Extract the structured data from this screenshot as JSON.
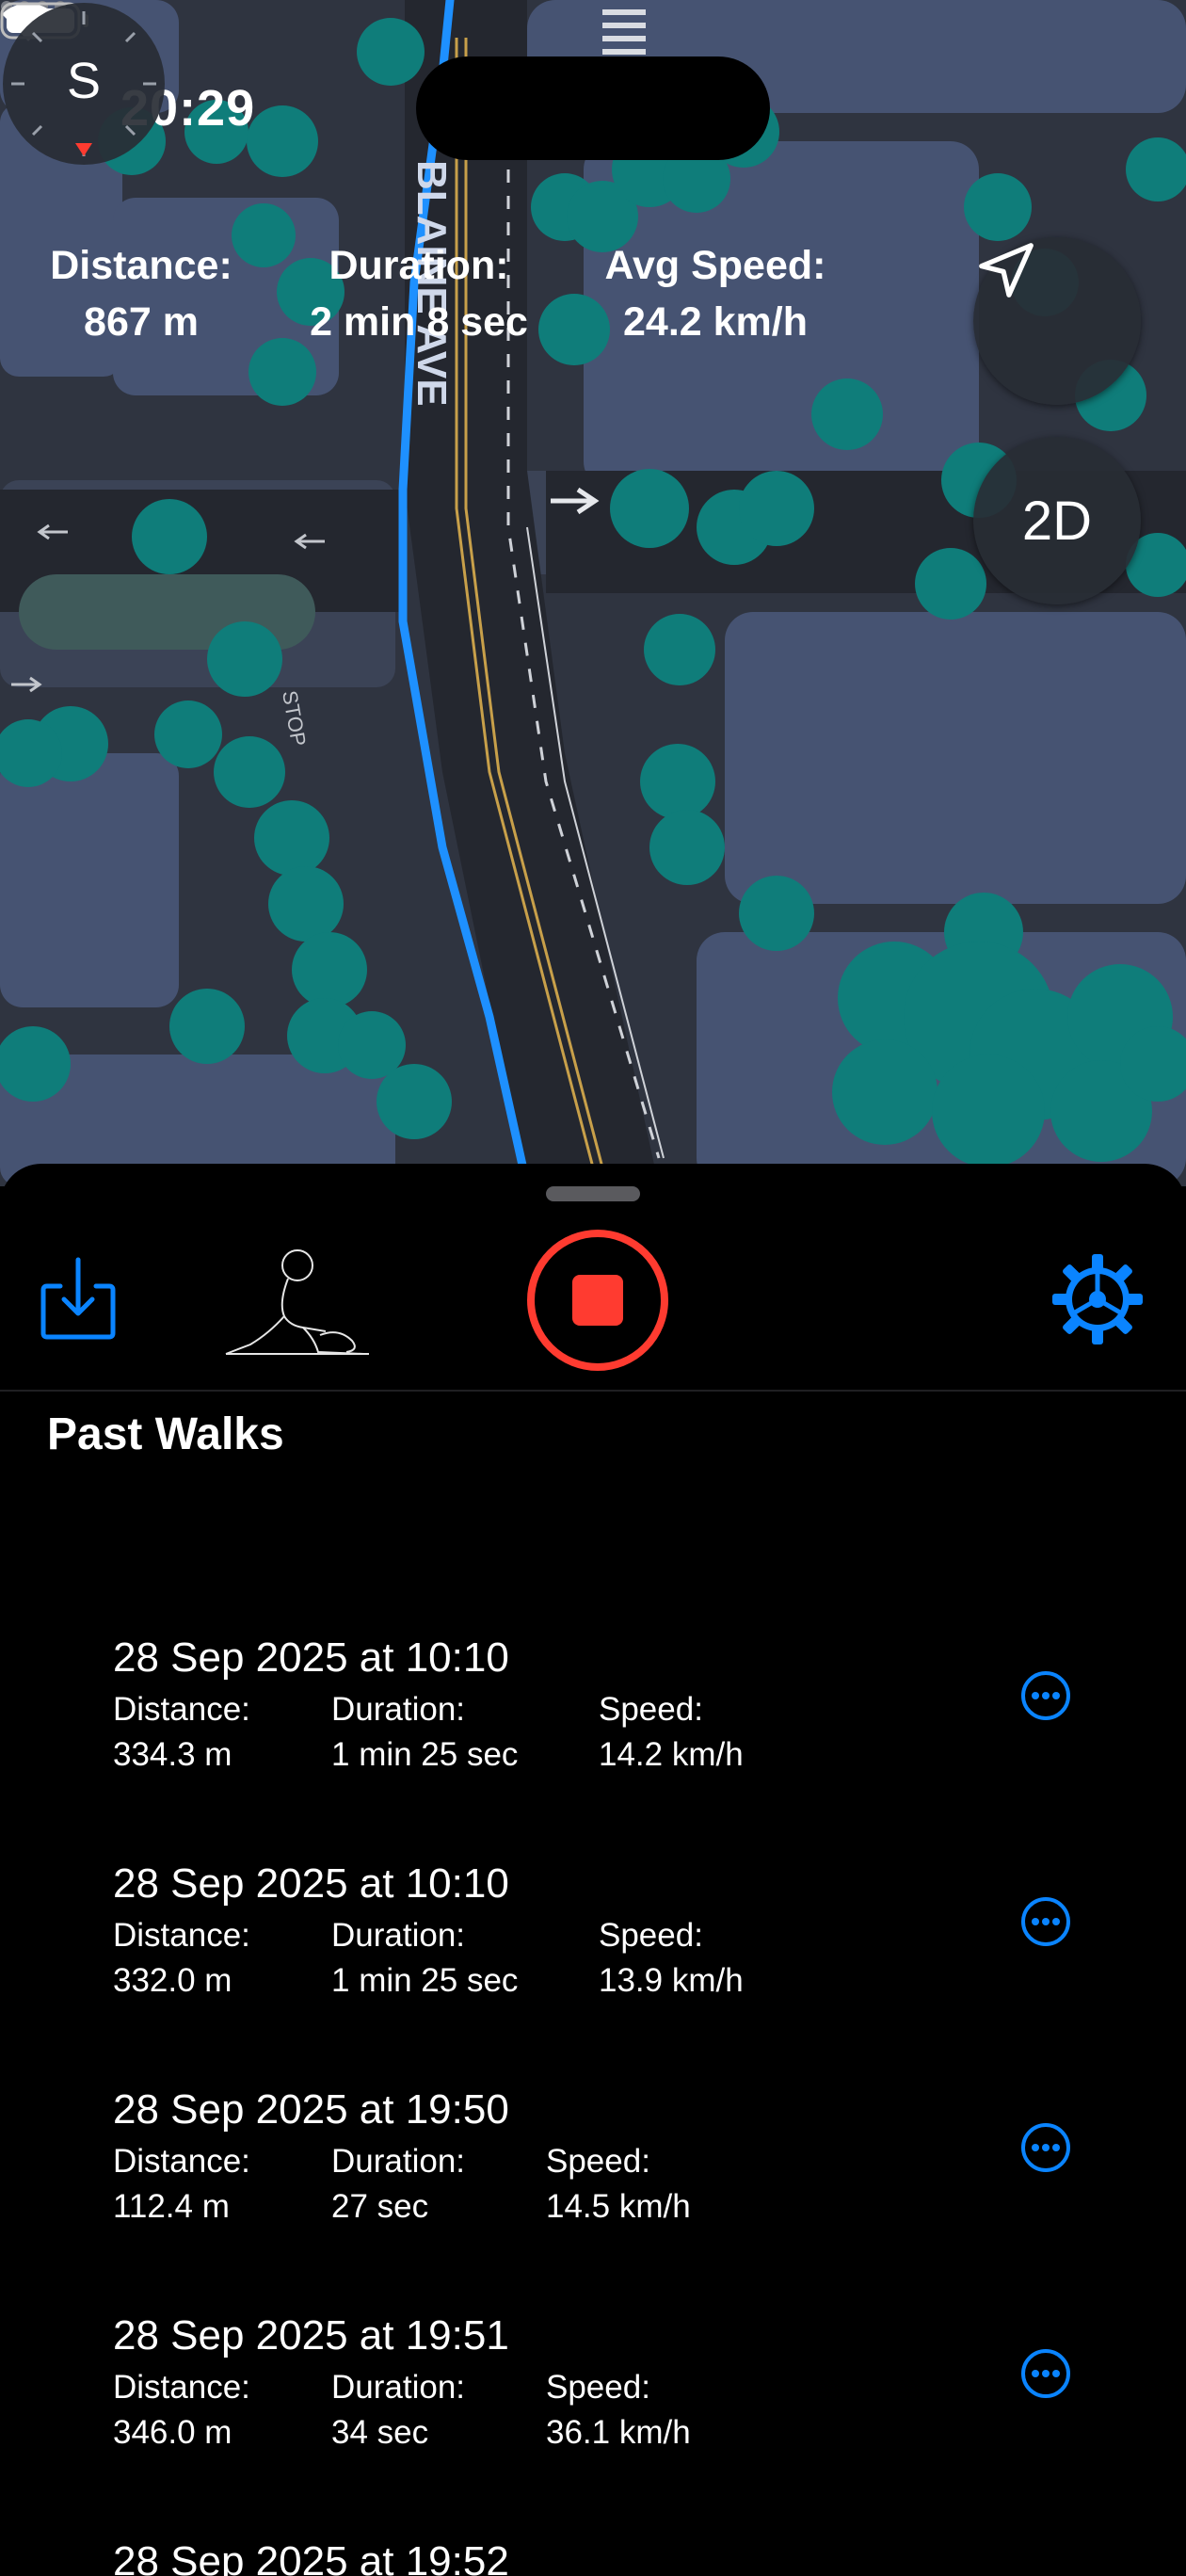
{
  "status_bar": {
    "time": "20:29"
  },
  "map": {
    "street_label": "BLAINE AVE",
    "stop_label": "STOP",
    "mode_button": "2D",
    "compass_heading": "S"
  },
  "stats": [
    {
      "label": "Distance:",
      "value": "867 m"
    },
    {
      "label": "Duration:",
      "value": "2 min 8 sec"
    },
    {
      "label": "Avg Speed:",
      "value": "24.2 km/h"
    }
  ],
  "sheet": {
    "title": "Past Walks",
    "walks": [
      {
        "date": "28 Sep 2025 at 10:10",
        "distance_label": "Distance:",
        "distance": "334.3 m",
        "duration_label": "Duration:",
        "duration": "1 min 25 sec",
        "speed_label": "Speed:",
        "speed": "14.2 km/h"
      },
      {
        "date": "28 Sep 2025 at 10:10",
        "distance_label": "Distance:",
        "distance": "332.0 m",
        "duration_label": "Duration:",
        "duration": "1 min 25 sec",
        "speed_label": "Speed:",
        "speed": "13.9 km/h"
      },
      {
        "date": "28 Sep 2025 at 19:50",
        "distance_label": "Distance:",
        "distance": "112.4 m",
        "duration_label": "Duration:",
        "duration": "27 sec",
        "speed_label": "Speed:",
        "speed": "14.5 km/h"
      },
      {
        "date": "28 Sep 2025 at 19:51",
        "distance_label": "Distance:",
        "distance": "346.0 m",
        "duration_label": "Duration:",
        "duration": "34 sec",
        "speed_label": "Speed:",
        "speed": "36.1 km/h"
      },
      {
        "date": "28 Sep 2025 at 19:52"
      }
    ]
  },
  "colors": {
    "accent": "#0a84ff",
    "route": "#1e90ff",
    "stop": "#ff3b30",
    "map_ground": "#2f3440",
    "building": "#4a5878",
    "tree": "#0f7d7a"
  },
  "icons": [
    "location-arrow-icon",
    "wifi-icon",
    "battery-icon",
    "navigation-arrow-icon",
    "compass-icon",
    "download-icon",
    "walker-icon",
    "stop-record-icon",
    "gear-icon",
    "more-icon"
  ]
}
